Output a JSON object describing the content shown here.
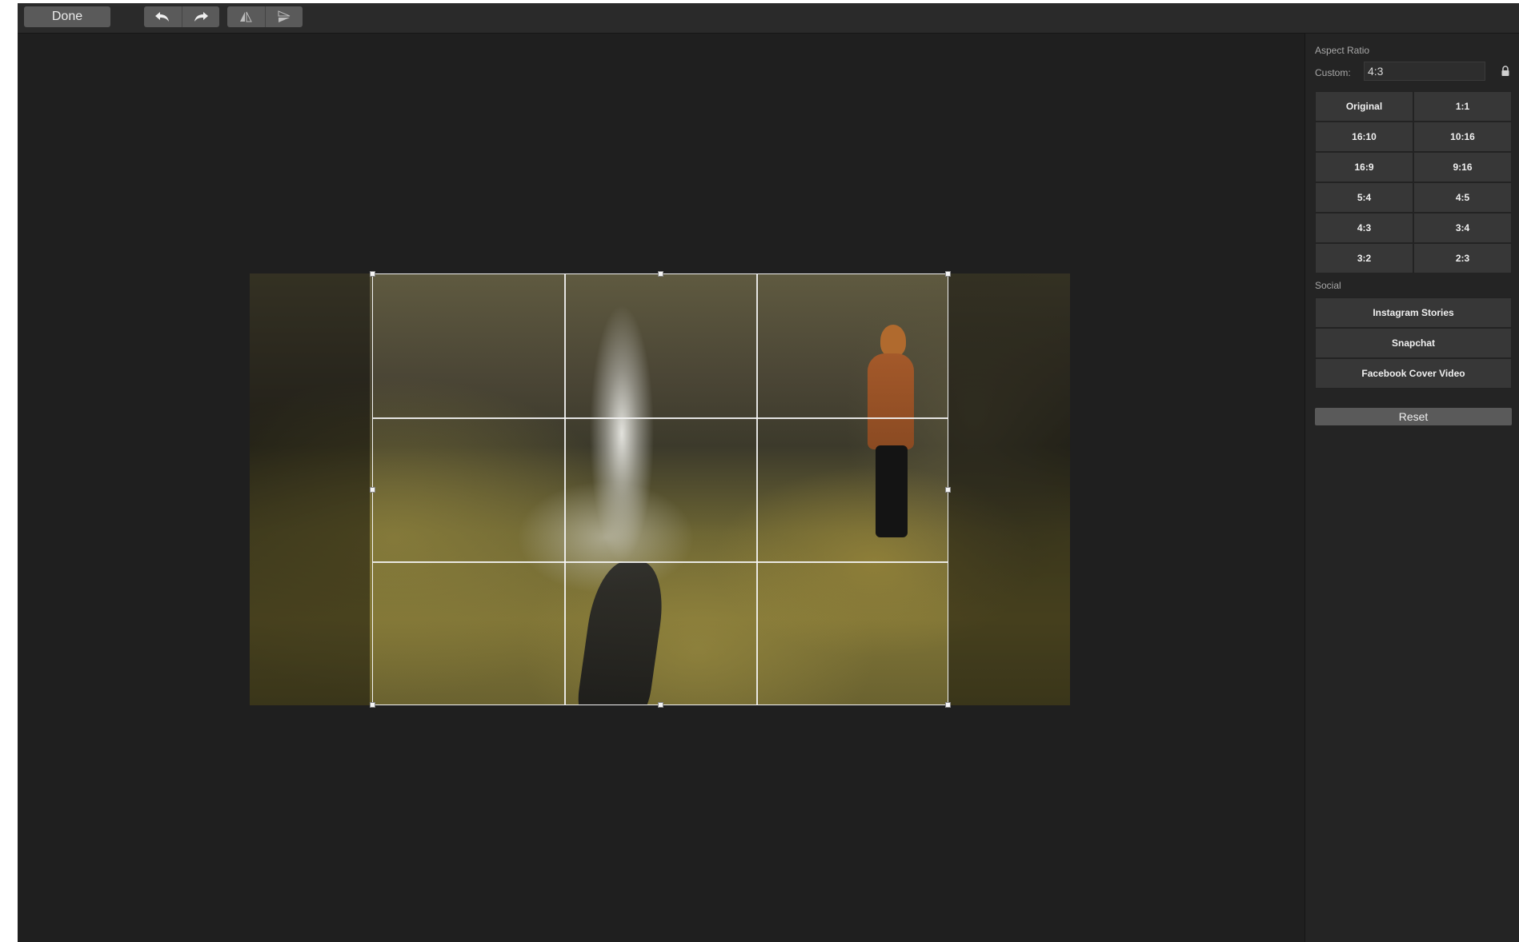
{
  "toolbar": {
    "done_label": "Done",
    "icons": [
      "undo-arrow-icon",
      "redo-arrow-icon",
      "flip-horizontal-icon",
      "flip-vertical-icon"
    ]
  },
  "sidebar": {
    "aspect_ratio_title": "Aspect Ratio",
    "custom_label": "Custom:",
    "custom_value": "4:3",
    "ratios": [
      {
        "label": "Original"
      },
      {
        "label": "1:1"
      },
      {
        "label": "16:10"
      },
      {
        "label": "10:16"
      },
      {
        "label": "16:9"
      },
      {
        "label": "9:16"
      },
      {
        "label": "5:4"
      },
      {
        "label": "4:5"
      },
      {
        "label": "4:3"
      },
      {
        "label": "3:4"
      },
      {
        "label": "3:2"
      },
      {
        "label": "2:3"
      }
    ],
    "social_title": "Social",
    "social": [
      {
        "label": "Instagram Stories"
      },
      {
        "label": "Snapchat"
      },
      {
        "label": "Facebook Cover Video"
      }
    ],
    "reset_label": "Reset"
  },
  "colors": {
    "background": "#1f1f1f",
    "toolbar": "#2a2a2a",
    "button": "#5a5a5a",
    "panel_button": "#373737",
    "crop_line": "#f2f2f2"
  }
}
